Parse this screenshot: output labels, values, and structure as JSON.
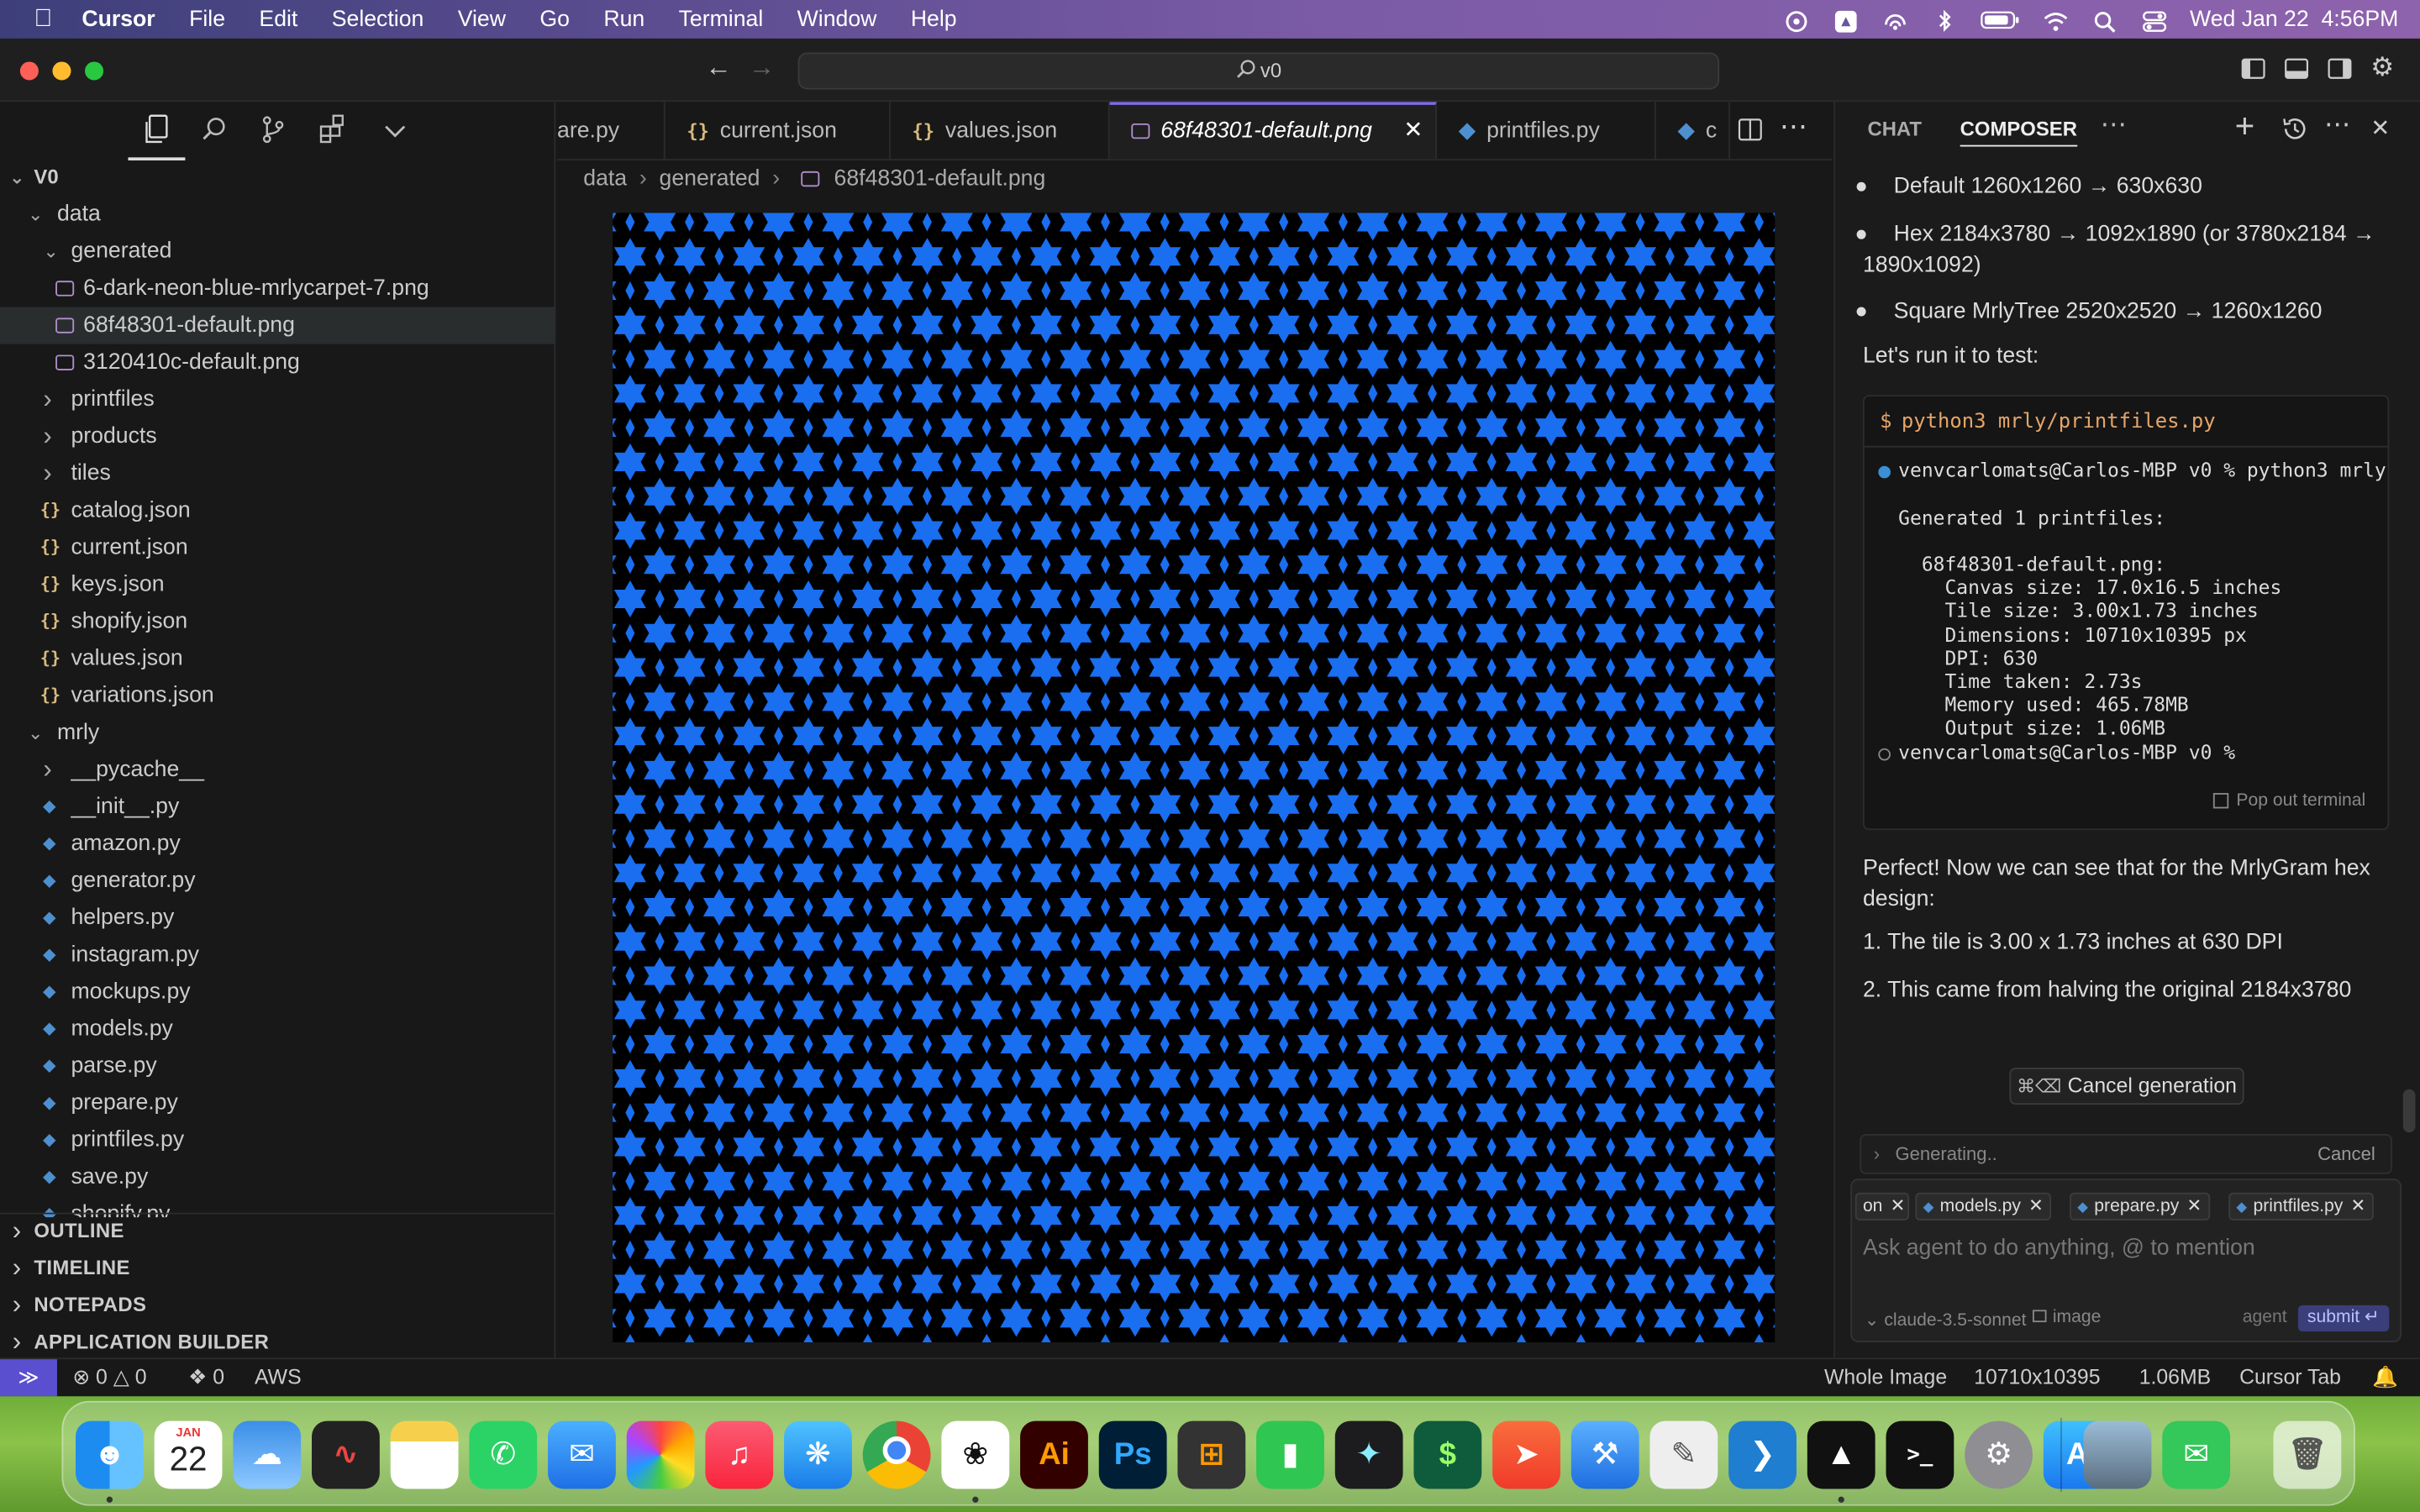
{
  "menubar": {
    "app": "Cursor",
    "items": [
      "File",
      "Edit",
      "Selection",
      "View",
      "Go",
      "Run",
      "Terminal",
      "Window",
      "Help"
    ],
    "clock": "Wed Jan 22  4:56PM"
  },
  "titlebar": {
    "search": "v0"
  },
  "explorer": {
    "root": "V0",
    "rows": [
      {
        "label": "data",
        "depth": 1,
        "kind": "folder-open"
      },
      {
        "label": "generated",
        "depth": 2,
        "kind": "folder-open"
      },
      {
        "label": "6-dark-neon-blue-mrlycarpet-7.png",
        "depth": 3,
        "kind": "img"
      },
      {
        "label": "68f48301-default.png",
        "depth": 3,
        "kind": "img",
        "selected": true
      },
      {
        "label": "3120410c-default.png",
        "depth": 3,
        "kind": "img"
      },
      {
        "label": "printfiles",
        "depth": 2,
        "kind": "folder"
      },
      {
        "label": "products",
        "depth": 2,
        "kind": "folder"
      },
      {
        "label": "tiles",
        "depth": 2,
        "kind": "folder"
      },
      {
        "label": "catalog.json",
        "depth": 2,
        "kind": "json"
      },
      {
        "label": "current.json",
        "depth": 2,
        "kind": "json"
      },
      {
        "label": "keys.json",
        "depth": 2,
        "kind": "json"
      },
      {
        "label": "shopify.json",
        "depth": 2,
        "kind": "json"
      },
      {
        "label": "values.json",
        "depth": 2,
        "kind": "json"
      },
      {
        "label": "variations.json",
        "depth": 2,
        "kind": "json"
      },
      {
        "label": "mrly",
        "depth": 1,
        "kind": "folder-open"
      },
      {
        "label": "__pycache__",
        "depth": 2,
        "kind": "folder"
      },
      {
        "label": "__init__.py",
        "depth": 2,
        "kind": "py"
      },
      {
        "label": "amazon.py",
        "depth": 2,
        "kind": "py"
      },
      {
        "label": "generator.py",
        "depth": 2,
        "kind": "py"
      },
      {
        "label": "helpers.py",
        "depth": 2,
        "kind": "py"
      },
      {
        "label": "instagram.py",
        "depth": 2,
        "kind": "py"
      },
      {
        "label": "mockups.py",
        "depth": 2,
        "kind": "py"
      },
      {
        "label": "models.py",
        "depth": 2,
        "kind": "py"
      },
      {
        "label": "parse.py",
        "depth": 2,
        "kind": "py"
      },
      {
        "label": "prepare.py",
        "depth": 2,
        "kind": "py"
      },
      {
        "label": "printfiles.py",
        "depth": 2,
        "kind": "py"
      },
      {
        "label": "save.py",
        "depth": 2,
        "kind": "py"
      },
      {
        "label": "shopify.py",
        "depth": 2,
        "kind": "py"
      }
    ],
    "sections": [
      "OUTLINE",
      "TIMELINE",
      "NOTEPADS",
      "APPLICATION BUILDER"
    ]
  },
  "tabs": [
    {
      "label": "are.py",
      "kind": "py"
    },
    {
      "label": "current.json",
      "kind": "json"
    },
    {
      "label": "values.json",
      "kind": "json"
    },
    {
      "label": "68f48301-default.png",
      "kind": "img",
      "active": true
    },
    {
      "label": "printfiles.py",
      "kind": "py"
    },
    {
      "label": "c",
      "kind": "py"
    }
  ],
  "breadcrumb": [
    "data",
    "generated",
    "68f48301-default.png"
  ],
  "pattern": {
    "star_color": "#1a6ef0",
    "background": "#000000"
  },
  "panel": {
    "tabs": [
      "CHAT",
      "COMPOSER"
    ],
    "bullets": [
      "Default 1260x1260 → 630x630",
      "Hex 2184x3780 → 1092x1890 (or 3780x2184 →",
      "1890x1092)",
      "Square MrlyTree 2520x2520 → 1260x1260"
    ],
    "intro": "Let's run it to test:",
    "terminal": {
      "command_prefix": "$",
      "command": "python3 mrly/printfiles.py",
      "prompt_line": "venvcarlomats@Carlos-MBP v0 % python3 mrly",
      "output": [
        "Generated 1 printfiles:",
        "",
        "  68f48301-default.png:",
        "    Canvas size: 17.0x16.5 inches",
        "    Tile size: 3.00x1.73 inches",
        "    Dimensions: 10710x10395 px",
        "    DPI: 630",
        "    Time taken: 2.73s",
        "    Memory used: 465.78MB",
        "    Output size: 1.06MB"
      ],
      "last_prompt": "venvcarlomats@Carlos-MBP v0 %",
      "popout": "Pop out terminal"
    },
    "summary1": "Perfect! Now we can see that for the MrlyGram hex",
    "summary2": "design:",
    "list": [
      "1. The tile is 3.00 x 1.73 inches at 630 DPI",
      "2. This came from halving the original 2184x3780"
    ],
    "cancel_shortcut": "⌘⌫",
    "cancel_label": "Cancel generation",
    "generating": "Generating..",
    "generating_cancel": "Cancel",
    "chips": [
      "on",
      "models.py",
      "prepare.py",
      "printfiles.py"
    ],
    "placeholder": "Ask agent to do anything, @ to mention",
    "model": "claude-3.5-sonnet",
    "image_label": "image",
    "mode": "agent",
    "submit": "submit ↵"
  },
  "statusbar": {
    "errors": "0",
    "warnings": "0",
    "ports": "0",
    "aws": "AWS",
    "view_mode": "Whole Image",
    "dimensions": "10710x10395",
    "size": "1.06MB",
    "cursor_tab": "Cursor Tab"
  },
  "dock": {
    "calendar_month": "JAN",
    "calendar_day": "22",
    "illustrator": "Ai",
    "photoshop": "Ps"
  }
}
